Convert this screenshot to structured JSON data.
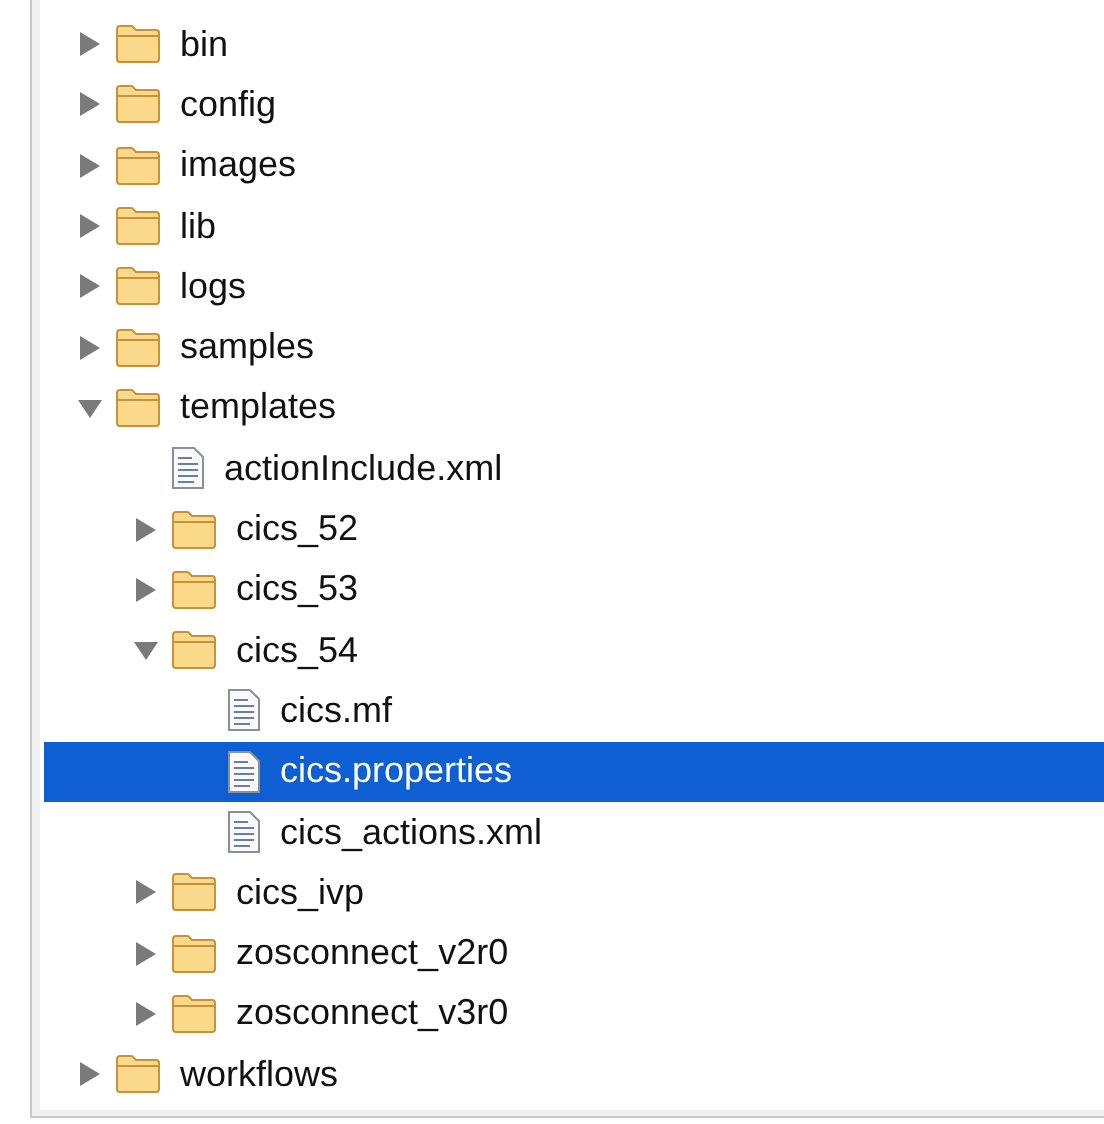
{
  "tree": [
    {
      "kind": "folder",
      "name": "bin",
      "expanded": false,
      "selected": false
    },
    {
      "kind": "folder",
      "name": "config",
      "expanded": false,
      "selected": false
    },
    {
      "kind": "folder",
      "name": "images",
      "expanded": false,
      "selected": false
    },
    {
      "kind": "folder",
      "name": "lib",
      "expanded": false,
      "selected": false
    },
    {
      "kind": "folder",
      "name": "logs",
      "expanded": false,
      "selected": false
    },
    {
      "kind": "folder",
      "name": "samples",
      "expanded": false,
      "selected": false
    },
    {
      "kind": "folder",
      "name": "templates",
      "expanded": true,
      "selected": false,
      "children": [
        {
          "kind": "file",
          "name": "actionInclude.xml",
          "selected": false
        },
        {
          "kind": "folder",
          "name": "cics_52",
          "expanded": false,
          "selected": false
        },
        {
          "kind": "folder",
          "name": "cics_53",
          "expanded": false,
          "selected": false
        },
        {
          "kind": "folder",
          "name": "cics_54",
          "expanded": true,
          "selected": false,
          "children": [
            {
              "kind": "file",
              "name": "cics.mf",
              "selected": false
            },
            {
              "kind": "file",
              "name": "cics.properties",
              "selected": true
            },
            {
              "kind": "file",
              "name": "cics_actions.xml",
              "selected": false
            }
          ]
        },
        {
          "kind": "folder",
          "name": "cics_ivp",
          "expanded": false,
          "selected": false
        },
        {
          "kind": "folder",
          "name": "zosconnect_v2r0",
          "expanded": false,
          "selected": false
        },
        {
          "kind": "folder",
          "name": "zosconnect_v3r0",
          "expanded": false,
          "selected": false
        }
      ]
    },
    {
      "kind": "folder",
      "name": "workflows",
      "expanded": false,
      "selected": false
    }
  ]
}
